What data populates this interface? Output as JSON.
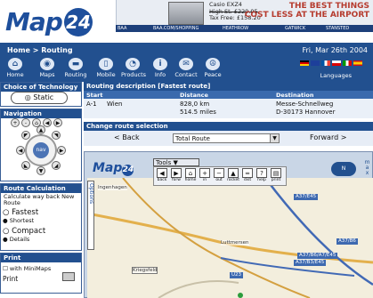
{
  "brand": {
    "logo_text": "Map",
    "logo_num": "24"
  },
  "ad": {
    "product": "Casio EXZ4",
    "high_st": "High St. £229.95",
    "tax_free": "Tax Free: £158.20",
    "headline1": "THE BEST THINGS",
    "headline2": "COST LESS AT THE AIRPORT",
    "strip": [
      "BAA",
      "BAA.COM/SHOPPING",
      "HEATHROW",
      "GATWICK",
      "STANSTED"
    ]
  },
  "header": {
    "breadcrumb": "Home > Routing",
    "date": "Fri, Mar 26th 2004",
    "nav": [
      "Home",
      "Maps",
      "Routing",
      "Mobile",
      "Products",
      "Info",
      "Contact",
      "Peace"
    ],
    "languages_label": "Languages"
  },
  "left": {
    "tech_title": "Choice of Technology",
    "static_label": "Static",
    "nav_title": "Navigation",
    "nav_center": "nav",
    "route_calc_title": "Route Calculation",
    "route_calc_desc": "Calculate way back New Route",
    "fastest": "Fastest",
    "shortest": "Shortest",
    "compact": "Compact",
    "details": "Details",
    "print_title": "Print",
    "with_minimaps": "with MiniMaps",
    "print_label": "Print"
  },
  "routing": {
    "desc_title": "Routing description [Fastest route]",
    "col_start": "Start",
    "col_distance": "Distance",
    "col_destination": "Destination",
    "start_code": "A-1",
    "start_city": "Wien",
    "distance_km": "828,0 km",
    "distance_miles": "514.5 miles",
    "dest1": "Messe-Schnellweg",
    "dest2": "D-30173 Hannover"
  },
  "route_selection": {
    "title": "Change route selection",
    "back": "< Back",
    "selected": "Total Route",
    "forward": "Forward >"
  },
  "map": {
    "logo_text": "Map",
    "logo_num": "24",
    "tools_label": "Tools",
    "toolbar": [
      "back",
      "forw",
      "home",
      "in",
      "out",
      "rocket",
      "dist",
      "help",
      "print"
    ],
    "options_label": "Options",
    "compass_label": "N",
    "labels": [
      "Ingenhagen",
      "Kriegsfeld",
      "Luttmersen",
      "A37/E45",
      "A37/B6",
      "A37/B6/A7/E45",
      "A37/B3/E45",
      "U23"
    ],
    "side_letters": [
      "m",
      "a",
      "x"
    ]
  },
  "colors": {
    "brand": "#1e4f9c",
    "header": "#22508f",
    "ad_accent": "#b63b2e"
  }
}
